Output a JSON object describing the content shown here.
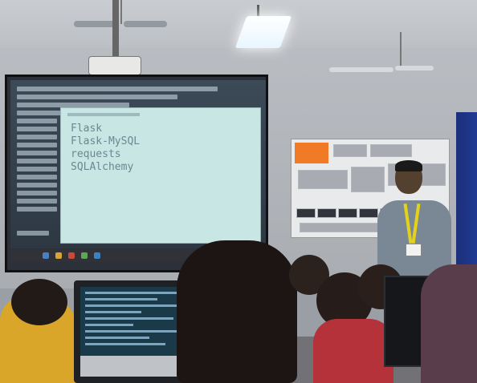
{
  "scene": {
    "description_tag": "classroom-workshop-photo"
  },
  "projection": {
    "requirements_list": [
      "Flask",
      "Flask-MySQL",
      "requests",
      "SQLAlchemy"
    ]
  },
  "colors": {
    "popup_bg": "#c8e6e4",
    "popup_text": "#6f8592",
    "poster_accent": "#f07a25",
    "lanyard": "#e4d21a"
  }
}
